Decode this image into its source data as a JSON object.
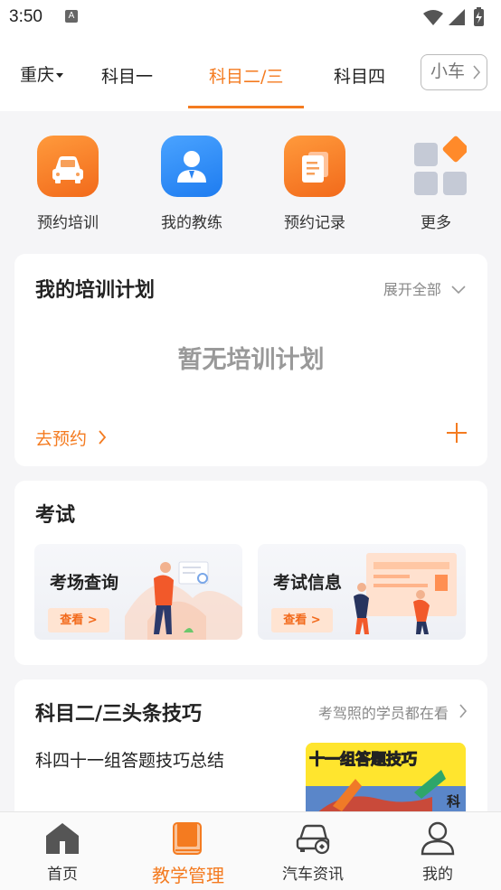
{
  "status": {
    "time": "3:50",
    "notif": "A"
  },
  "city": "重庆",
  "tabs": [
    {
      "label": "科目一",
      "active": false
    },
    {
      "label": "科目二/三",
      "active": true
    },
    {
      "label": "科目四",
      "active": false
    },
    {
      "label": "小车",
      "active": false
    }
  ],
  "quick": [
    {
      "label": "预约培训",
      "icon": "car-icon"
    },
    {
      "label": "我的教练",
      "icon": "coach-icon"
    },
    {
      "label": "预约记录",
      "icon": "record-icon"
    },
    {
      "label": "更多",
      "icon": "grid-icon"
    }
  ],
  "plan": {
    "title": "我的培训计划",
    "expand": "展开全部",
    "empty": "暂无培训计划",
    "go": "去预约"
  },
  "exam": {
    "title": "考试",
    "venue": {
      "title": "考场查询",
      "btn": "查看 >"
    },
    "info": {
      "title": "考试信息",
      "btn": "查看 >"
    }
  },
  "tips": {
    "title": "科目二/三头条技巧",
    "sub": "考驾照的学员都在看",
    "article": "科四十一组答题技巧总结",
    "thumb_text": "十一组答题技巧",
    "thumb_side": "科"
  },
  "nav": [
    {
      "label": "首页",
      "active": false
    },
    {
      "label": "教学管理",
      "active": true
    },
    {
      "label": "汽车资讯",
      "active": false
    },
    {
      "label": "我的",
      "active": false
    }
  ],
  "colors": {
    "accent": "#f47b20",
    "blue": "#1e7cf0"
  }
}
